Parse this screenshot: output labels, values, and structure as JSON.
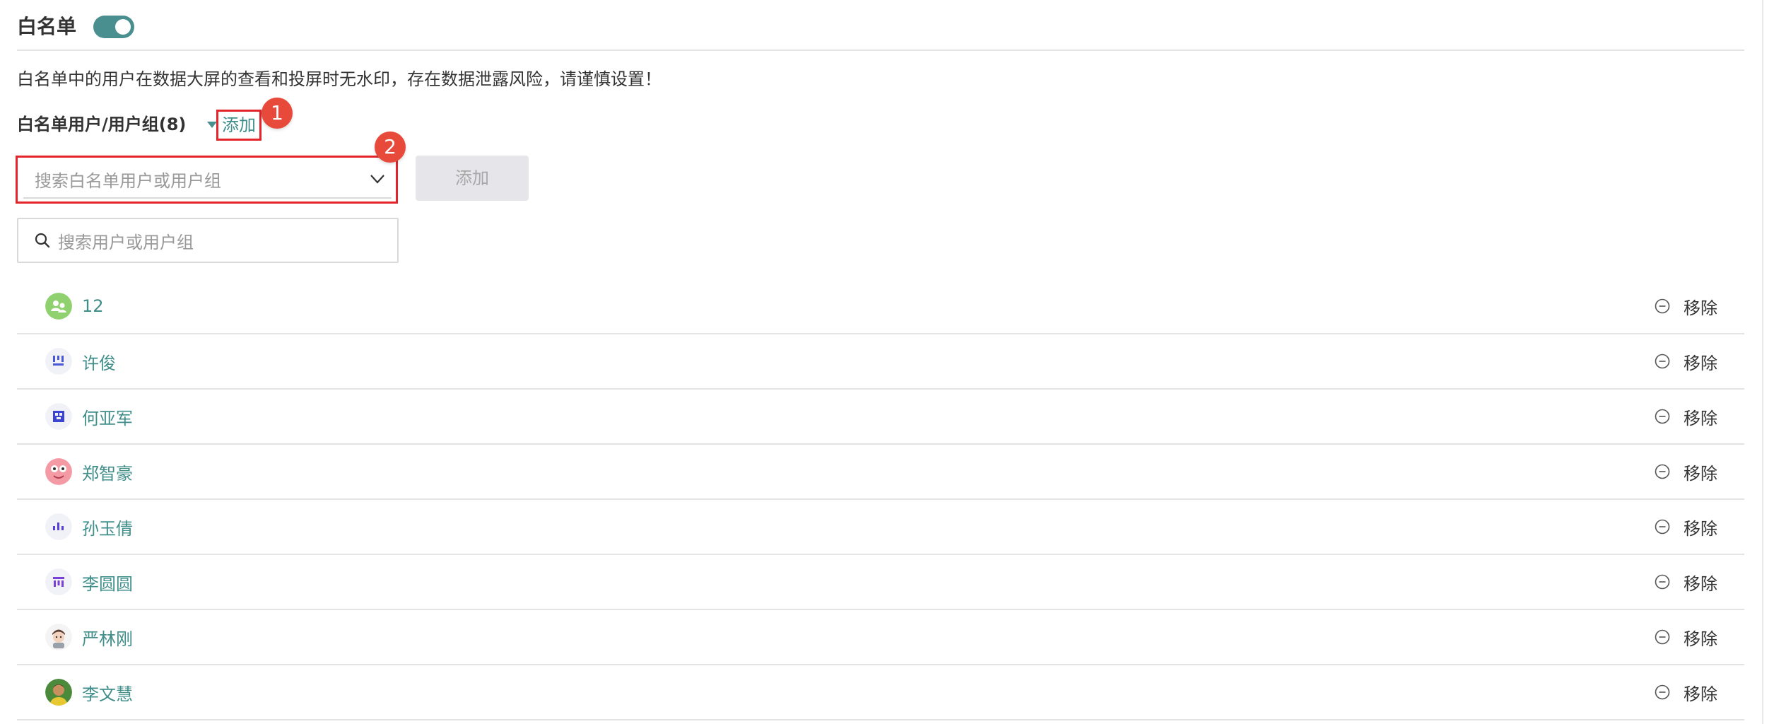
{
  "header": {
    "title": "白名单",
    "toggle_on": true
  },
  "description": "白名单中的用户在数据大屏的查看和投屏时无水印，存在数据泄露风险，请谨慎设置！",
  "list_header": {
    "title": "白名单用户/用户组(8)",
    "add_link": "添加"
  },
  "badges": {
    "first": "1",
    "second": "2"
  },
  "add_form": {
    "select_placeholder": "搜索白名单用户或用户组",
    "add_button": "添加"
  },
  "search": {
    "placeholder": "搜索用户或用户组"
  },
  "members": [
    {
      "name": "12",
      "avatar": "group-avatar",
      "remove": "移除"
    },
    {
      "name": "许俊",
      "avatar": "pattern-avatar-blue",
      "remove": "移除"
    },
    {
      "name": "何亚军",
      "avatar": "pattern-avatar-indigo",
      "remove": "移除"
    },
    {
      "name": "郑智豪",
      "avatar": "cartoon-avatar-pink",
      "remove": "移除"
    },
    {
      "name": "孙玉倩",
      "avatar": "pattern-avatar-purple",
      "remove": "移除"
    },
    {
      "name": "李圆圆",
      "avatar": "pattern-avatar-violet",
      "remove": "移除"
    },
    {
      "name": "严林刚",
      "avatar": "cartoon-avatar-boy",
      "remove": "移除"
    },
    {
      "name": "李文慧",
      "avatar": "photo-avatar",
      "remove": "移除"
    }
  ],
  "colors": {
    "accent": "#3f8e8a",
    "toggle": "#4a8f8f",
    "highlight": "#e3242b",
    "badge": "#e74a3b"
  }
}
